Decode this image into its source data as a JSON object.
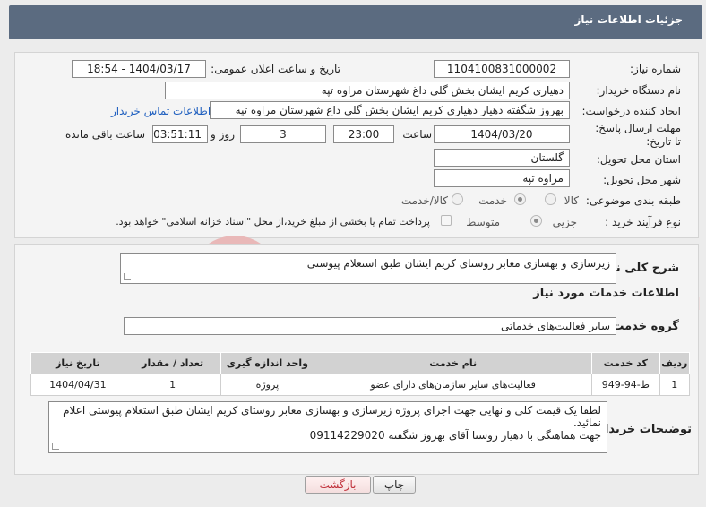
{
  "header": {
    "title": "جزئیات اطلاعات نیاز"
  },
  "form": {
    "need_number_label": "شماره نیاز:",
    "need_number": "1104100831000002",
    "announce_label": "تاریخ و ساعت اعلان عمومی:",
    "announce_value": "1404/03/17 - 18:54",
    "buyer_org_label": "نام دستگاه خریدار:",
    "buyer_org": "دهیاری کریم ایشان بخش گلی داغ شهرستان مراوه تپه",
    "creator_label": "ایجاد کننده درخواست:",
    "creator": "بهروز شگفته دهیار دهیاری کریم ایشان بخش گلی داغ شهرستان مراوه تپه",
    "contact_link": "اطلاعات تماس خریدار",
    "deadline_label": "مهلت ارسال پاسخ: تا تاریخ:",
    "deadline_date": "1404/03/20",
    "time_label": "ساعت",
    "deadline_time": "23:00",
    "days_value": "3",
    "days_label": "روز و",
    "remaining_time": "03:51:11",
    "remaining_label": "ساعت باقی مانده",
    "province_label": "استان محل تحویل:",
    "province": "گلستان",
    "city_label": "شهر محل تحویل:",
    "city": "مراوه تپه",
    "category_label": "طبقه بندی موضوعی:",
    "category_options": [
      "کالا",
      "خدمت",
      "کالا/خدمت"
    ],
    "category_selected": "خدمت",
    "process_label": "نوع فرآیند خرید :",
    "process_options": [
      "جزیی",
      "متوسط"
    ],
    "process_selected": "جزیی",
    "payment_note": "پرداخت تمام یا بخشی از مبلغ خرید،از محل \"اسناد خزانه اسلامی\" خواهد بود."
  },
  "summary": {
    "label": "شرح کلی نیاز:",
    "text": "زیرسازی و بهسازی معابر روستای کریم ایشان طبق استعلام پیوستی"
  },
  "services": {
    "heading": "اطلاعات خدمات مورد نیاز",
    "group_label": "گروه خدمت:",
    "group_value": "سایر فعالیت‌های خدماتی",
    "columns": [
      "ردیف",
      "کد خدمت",
      "نام خدمت",
      "واحد اندازه گیری",
      "تعداد / مقدار",
      "تاریخ نیاز"
    ],
    "rows": [
      [
        "1",
        "ط-94-949",
        "فعالیت‌های سایر سازمان‌های دارای عضو",
        "پروژه",
        "1",
        "1404/04/31"
      ]
    ]
  },
  "notes": {
    "label": "توضیحات خریدار:",
    "line1": "لطفا یک قیمت کلی و نهایی جهت اجرای پروژه زیرسازی و بهسازی معابر روستای کریم ایشان طبق استعلام پیوستی اعلام نمائید.",
    "line2": "جهت هماهنگی با دهیار روستا آقای بهروز شگفته 09114229020"
  },
  "buttons": {
    "print": "چاپ",
    "back": "بازگشت"
  },
  "watermark": {
    "text": "AriaTender.neT"
  },
  "colors": {
    "header": "#5b6b80",
    "link": "#1f5fbf",
    "back_button_text": "#c0303a",
    "watermark": "#e9b8b8"
  }
}
